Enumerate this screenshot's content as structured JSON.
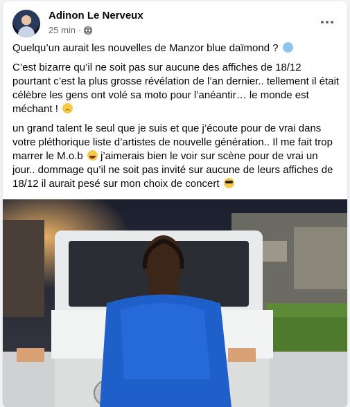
{
  "post": {
    "author": "Adinon Le Nerveux",
    "time": "25 min",
    "separator": "·",
    "paragraphs": [
      "Quelqu’un aurait les nouvelles de Manzor blue daïmond ?",
      "C’est bizarre qu’il ne soit pas sur aucune des affiches de 18/12 pourtant c’est la plus grosse révélation de l’an dernier.. tellement il était célèbre les gens ont volé sa moto pour l’anéantir… le monde est méchant !",
      "un grand talent le seul que je suis et que j’écoute pour de vrai dans votre pléthorique liste d’artistes de nouvelle génération.. Il me fait trop marrer le M.o.b",
      "j’aimerais bien le voir sur scène pour de vrai un jour.. dommage qu’il ne soit pas invité sur aucune de leurs affiches de 18/12 il aurait pesé sur mon choix de concert"
    ],
    "icons": {
      "avatar": "profile-avatar",
      "privacy": "globe-icon",
      "menu": "more-options-icon"
    }
  },
  "colors": {
    "page_bg": "#f0f2f5",
    "card_bg": "#ffffff",
    "secondary_text": "#65676b",
    "primary_text": "#050505"
  }
}
